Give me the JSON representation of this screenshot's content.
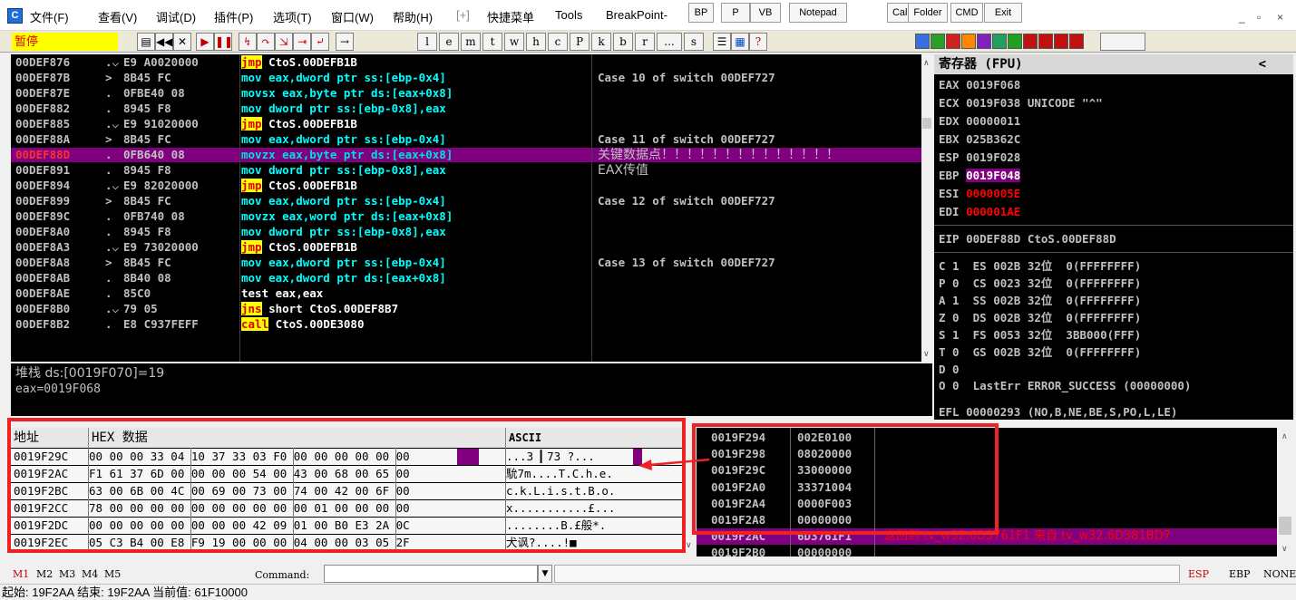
{
  "menubar": {
    "items": [
      "文件(F)",
      "查看(V)",
      "调试(D)",
      "插件(P)",
      "选项(T)",
      "窗口(W)",
      "帮助(H)",
      "[+]",
      "快捷菜单",
      "Tools",
      "BreakPoint-"
    ],
    "quick_buttons": [
      "BP",
      "P",
      "VB",
      "Notepad",
      "Calc",
      "Folder",
      "CMD",
      "Exit"
    ],
    "window_controls": [
      "_",
      "▫",
      "×"
    ]
  },
  "toolbar": {
    "status": "暂停",
    "letter_buttons": [
      "l",
      "e",
      "m",
      "t",
      "w",
      "h",
      "c",
      "P",
      "k",
      "b",
      "r",
      "...",
      "s"
    ],
    "plugin_icon_colors": [
      "#3a6fe0",
      "#2aa02a",
      "#d02020",
      "#ff8800",
      "#8020c0",
      "#20a060",
      "#20a020",
      "#c01010",
      "#c01010",
      "#c01010",
      "#c01010"
    ]
  },
  "disasm": {
    "rows": [
      {
        "addr": "00DEF876",
        "mark": ".⌵",
        "hex": "E9 A0020000",
        "ins": "jmp",
        "args": " CtoS.00DEFB1B",
        "kind": "jmp",
        "cmt": ""
      },
      {
        "addr": "00DEF87B",
        "mark": ">",
        "hex": "8B45 FC",
        "ins": "mov eax,dword ptr ss:[ebp-0x4]",
        "args": "",
        "kind": "mov",
        "cmt": "Case 10 of switch 00DEF727"
      },
      {
        "addr": "00DEF87E",
        "mark": ".",
        "hex": "0FBE40 08",
        "ins": "movsx eax,byte ptr ds:[eax+0x8]",
        "args": "",
        "kind": "mov",
        "cmt": ""
      },
      {
        "addr": "00DEF882",
        "mark": ".",
        "hex": "8945 F8",
        "ins": "mov dword ptr ss:[ebp-0x8],eax",
        "args": "",
        "kind": "mov",
        "cmt": ""
      },
      {
        "addr": "00DEF885",
        "mark": ".⌵",
        "hex": "E9 91020000",
        "ins": "jmp",
        "args": " CtoS.00DEFB1B",
        "kind": "jmp",
        "cmt": ""
      },
      {
        "addr": "00DEF88A",
        "mark": ">",
        "hex": "8B45 FC",
        "ins": "mov eax,dword ptr ss:[ebp-0x4]",
        "args": "",
        "kind": "mov",
        "cmt": "Case 11 of switch 00DEF727"
      },
      {
        "addr": "00DEF88D",
        "mark": ".",
        "hex": "0FB640 08",
        "ins": "movzx eax,byte ptr ds:[eax+0x8]",
        "args": "",
        "kind": "sel",
        "cmt": "关键数据点！！！！！！！！！！！！！！"
      },
      {
        "addr": "00DEF891",
        "mark": ".",
        "hex": "8945 F8",
        "ins": "mov dword ptr ss:[ebp-0x8],eax",
        "args": "",
        "kind": "mov",
        "cmt": "EAX传值"
      },
      {
        "addr": "00DEF894",
        "mark": ".⌵",
        "hex": "E9 82020000",
        "ins": "jmp",
        "args": " CtoS.00DEFB1B",
        "kind": "jmp",
        "cmt": ""
      },
      {
        "addr": "00DEF899",
        "mark": ">",
        "hex": "8B45 FC",
        "ins": "mov eax,dword ptr ss:[ebp-0x4]",
        "args": "",
        "kind": "mov",
        "cmt": "Case 12 of switch 00DEF727"
      },
      {
        "addr": "00DEF89C",
        "mark": ".",
        "hex": "0FB740 08",
        "ins": "movzx eax,word ptr ds:[eax+0x8]",
        "args": "",
        "kind": "mov",
        "cmt": ""
      },
      {
        "addr": "00DEF8A0",
        "mark": ".",
        "hex": "8945 F8",
        "ins": "mov dword ptr ss:[ebp-0x8],eax",
        "args": "",
        "kind": "mov",
        "cmt": ""
      },
      {
        "addr": "00DEF8A3",
        "mark": ".⌵",
        "hex": "E9 73020000",
        "ins": "jmp",
        "args": " CtoS.00DEFB1B",
        "kind": "jmp",
        "cmt": ""
      },
      {
        "addr": "00DEF8A8",
        "mark": ">",
        "hex": "8B45 FC",
        "ins": "mov eax,dword ptr ss:[ebp-0x4]",
        "args": "",
        "kind": "mov",
        "cmt": "Case 13 of switch 00DEF727"
      },
      {
        "addr": "00DEF8AB",
        "mark": ".",
        "hex": "8B40 08",
        "ins": "mov eax,dword ptr ds:[eax+0x8]",
        "args": "",
        "kind": "mov",
        "cmt": ""
      },
      {
        "addr": "00DEF8AE",
        "mark": ".",
        "hex": "85C0",
        "ins": "test eax,eax",
        "args": "",
        "kind": "plain",
        "cmt": ""
      },
      {
        "addr": "00DEF8B0",
        "mark": ".⌵",
        "hex": "79 05",
        "ins": "jns",
        "args": " short CtoS.00DEF8B7",
        "kind": "jmp",
        "cmt": ""
      },
      {
        "addr": "00DEF8B2",
        "mark": ".",
        "hex": "E8 C937FEFF",
        "ins": "call",
        "args": " CtoS.00DE3080",
        "kind": "jmp",
        "cmt": ""
      }
    ]
  },
  "info": {
    "line1": "堆栈 ds:[0019F070]=19",
    "line2": "eax=0019F068"
  },
  "registers": {
    "title": "寄存器 (FPU)",
    "back": "<",
    "gp": [
      {
        "name": "EAX",
        "val": "0019F068",
        "extra": "",
        "style": "normal"
      },
      {
        "name": "ECX",
        "val": "0019F038",
        "extra": " UNICODE \"^\"",
        "style": "normal"
      },
      {
        "name": "EDX",
        "val": "00000011",
        "extra": "",
        "style": "normal"
      },
      {
        "name": "EBX",
        "val": "025B362C",
        "extra": "",
        "style": "normal"
      },
      {
        "name": "ESP",
        "val": "0019F028",
        "extra": "",
        "style": "normal"
      },
      {
        "name": "EBP",
        "val": "0019F048",
        "extra": "",
        "style": "hl"
      },
      {
        "name": "ESI",
        "val": "0000005E",
        "extra": "",
        "style": "red"
      },
      {
        "name": "EDI",
        "val": "000001AE",
        "extra": "",
        "style": "red"
      }
    ],
    "eip": "EIP 00DEF88D CtoS.00DEF88D",
    "segs": [
      "C 1  ES 002B 32位  0(FFFFFFFF)",
      "P 0  CS 0023 32位  0(FFFFFFFF)",
      "A 1  SS 002B 32位  0(FFFFFFFF)",
      "Z 0  DS 002B 32位  0(FFFFFFFF)",
      "S 1  FS 0053 32位  3BB000(FFF)",
      "T 0  GS 002B 32位  0(FFFFFFFF)",
      "D 0",
      "O 0  LastErr ERROR_SUCCESS (00000000)"
    ],
    "efl": "EFL 00000293 (NO,B,NE,BE,S,PO,L,LE)"
  },
  "dump": {
    "headers": [
      "地址",
      "HEX 数据",
      "ASCII"
    ],
    "rows": [
      {
        "addr": "0019F29C",
        "hex": "00 00 00 33 04 10 37 33 03 F0 00 00 00 00 00 00",
        "ascii": "...3 ▎73 ?..."
      },
      {
        "addr": "0019F2AC",
        "hex": "F1 61 37 6D 00 00 00 00 54 00 43 00 68 00 65 00",
        "ascii": "馻7m....T.C.h.e."
      },
      {
        "addr": "0019F2BC",
        "hex": "63 00 6B 00 4C 00 69 00 73 00 74 00 42 00 6F 00",
        "ascii": "c.k.L.i.s.t.B.o."
      },
      {
        "addr": "0019F2CC",
        "hex": "78 00 00 00 00 00 00 00 00 00 00 01 00 00 00 00",
        "ascii": "x...........£..."
      },
      {
        "addr": "0019F2DC",
        "hex": "00 00 00 00 00 00 00 00 42 09 01 00 B0 E3 2A 0C",
        "ascii": "........B.£般*."
      },
      {
        "addr": "0019F2EC",
        "hex": "05 C3 B4 00 E8 F9 19 00 00 00 04 00 00 03 05 2F",
        "ascii": "犬讽?....!■"
      }
    ]
  },
  "stack": {
    "rows": [
      {
        "addr": "0019F294",
        "val": "002E0100",
        "cmt": "",
        "sel": false
      },
      {
        "addr": "0019F298",
        "val": "08020000",
        "cmt": "",
        "sel": false
      },
      {
        "addr": "0019F29C",
        "val": "33000000",
        "cmt": "",
        "sel": false
      },
      {
        "addr": "0019F2A0",
        "val": "33371004",
        "cmt": "",
        "sel": false
      },
      {
        "addr": "0019F2A4",
        "val": "0000F003",
        "cmt": "",
        "sel": false
      },
      {
        "addr": "0019F2A8",
        "val": "00000000",
        "cmt": "",
        "sel": false
      },
      {
        "addr": "0019F2AC",
        "val": "6D3761F1",
        "cmt": "返回到 tv_w32.6D3761F1 来自 tv_w32.6D381BD7",
        "sel": true
      },
      {
        "addr": "0019F2B0",
        "val": "00000000",
        "cmt": "",
        "sel": false
      }
    ]
  },
  "cmdbar": {
    "tabs": [
      "M1",
      "M2",
      "M3",
      "M4",
      "M5"
    ],
    "label": "Command:",
    "regs": [
      "ESP",
      "EBP",
      "NONE"
    ]
  },
  "status": {
    "text": "起始: 19F2AA 结束: 19F2AA 当前值: 61F10000"
  },
  "colors": {
    "annotation_red": "#ee2222",
    "selection_purple": "#800080",
    "jump_highlight": "#ffff00"
  }
}
